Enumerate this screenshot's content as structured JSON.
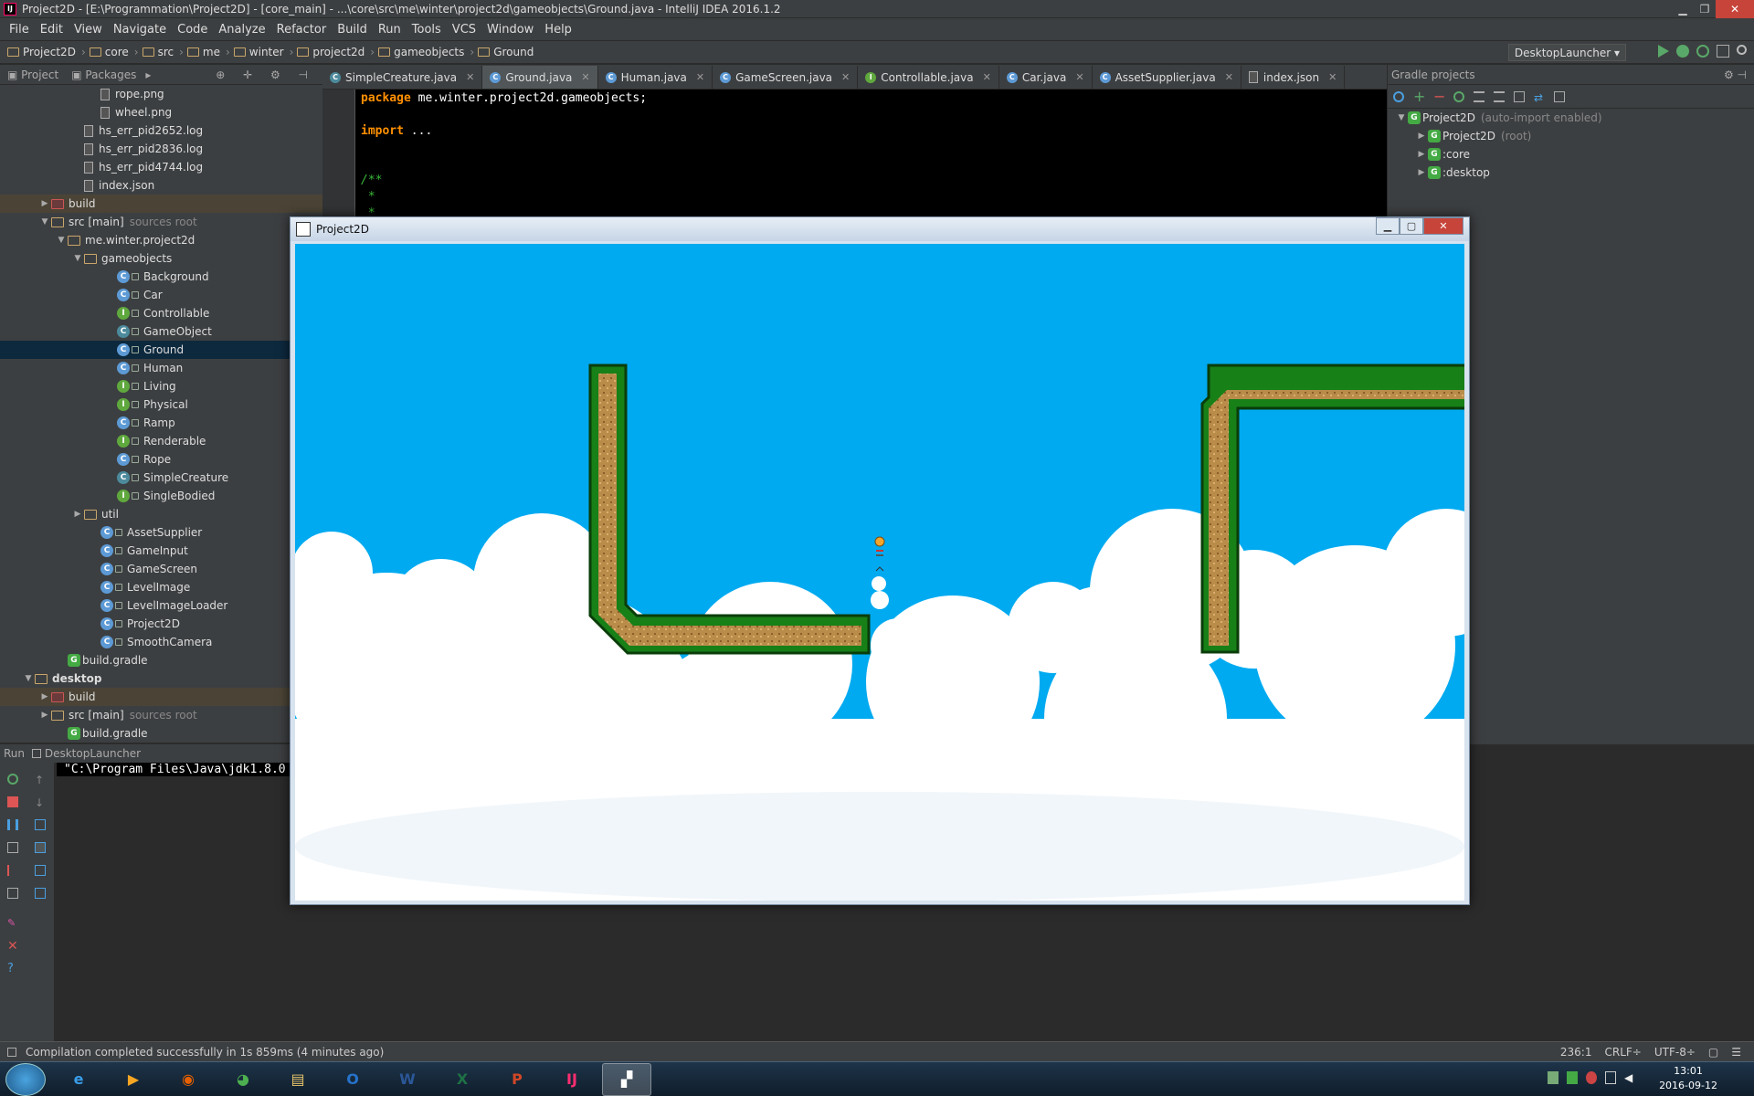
{
  "window": {
    "title": "Project2D - [E:\\Programmation\\Project2D] - [core_main] - ...\\core\\src\\me\\winter\\project2d\\gameobjects\\Ground.java - IntelliJ IDEA 2016.1.2",
    "logo": "IJ"
  },
  "menu": [
    "File",
    "Edit",
    "View",
    "Navigate",
    "Code",
    "Analyze",
    "Refactor",
    "Build",
    "Run",
    "Tools",
    "VCS",
    "Window",
    "Help"
  ],
  "breadcrumb": [
    "Project2D",
    "core",
    "src",
    "me",
    "winter",
    "project2d",
    "gameobjects",
    "Ground"
  ],
  "run_config": "DesktopLauncher",
  "project_panel": {
    "tabs": [
      "Project",
      "Packages"
    ],
    "tree": [
      {
        "label": "rope.png",
        "indent": 5,
        "icon": "file"
      },
      {
        "label": "wheel.png",
        "indent": 5,
        "icon": "file"
      },
      {
        "label": "hs_err_pid2652.log",
        "indent": 4,
        "icon": "file"
      },
      {
        "label": "hs_err_pid2836.log",
        "indent": 4,
        "icon": "file"
      },
      {
        "label": "hs_err_pid4744.log",
        "indent": 4,
        "icon": "file"
      },
      {
        "label": "index.json",
        "indent": 4,
        "icon": "file"
      },
      {
        "label": "build",
        "indent": 2,
        "icon": "folder-red",
        "arrow": "▶",
        "hl": true
      },
      {
        "label": "src [main]",
        "suffix": "sources root",
        "indent": 2,
        "icon": "folder",
        "arrow": "▼"
      },
      {
        "label": "me.winter.project2d",
        "indent": 3,
        "icon": "folder",
        "arrow": "▼"
      },
      {
        "label": "gameobjects",
        "indent": 4,
        "icon": "folder",
        "arrow": "▼"
      },
      {
        "label": "Background",
        "indent": 6,
        "icon": "c"
      },
      {
        "label": "Car",
        "indent": 6,
        "icon": "c"
      },
      {
        "label": "Controllable",
        "indent": 6,
        "icon": "i"
      },
      {
        "label": "GameObject",
        "indent": 6,
        "icon": "a"
      },
      {
        "label": "Ground",
        "indent": 6,
        "icon": "c",
        "sel": true
      },
      {
        "label": "Human",
        "indent": 6,
        "icon": "c"
      },
      {
        "label": "Living",
        "indent": 6,
        "icon": "i"
      },
      {
        "label": "Physical",
        "indent": 6,
        "icon": "i"
      },
      {
        "label": "Ramp",
        "indent": 6,
        "icon": "c"
      },
      {
        "label": "Renderable",
        "indent": 6,
        "icon": "i"
      },
      {
        "label": "Rope",
        "indent": 6,
        "icon": "c"
      },
      {
        "label": "SimpleCreature",
        "indent": 6,
        "icon": "a"
      },
      {
        "label": "SingleBodied",
        "indent": 6,
        "icon": "i"
      },
      {
        "label": "util",
        "indent": 4,
        "icon": "folder",
        "arrow": "▶"
      },
      {
        "label": "AssetSupplier",
        "indent": 5,
        "icon": "c"
      },
      {
        "label": "GameInput",
        "indent": 5,
        "icon": "c"
      },
      {
        "label": "GameScreen",
        "indent": 5,
        "icon": "c"
      },
      {
        "label": "LevelImage",
        "indent": 5,
        "icon": "c"
      },
      {
        "label": "LevelImageLoader",
        "indent": 5,
        "icon": "c"
      },
      {
        "label": "Project2D",
        "indent": 5,
        "icon": "c"
      },
      {
        "label": "SmoothCamera",
        "indent": 5,
        "icon": "c"
      },
      {
        "label": "build.gradle",
        "indent": 3,
        "icon": "g"
      },
      {
        "label": "desktop",
        "indent": 1,
        "icon": "folder",
        "arrow": "▼",
        "bold": true
      },
      {
        "label": "build",
        "indent": 2,
        "icon": "folder-red",
        "arrow": "▶",
        "hl": true
      },
      {
        "label": "src [main]",
        "suffix": "sources root",
        "indent": 2,
        "icon": "folder",
        "arrow": "▶"
      },
      {
        "label": "build.gradle",
        "indent": 3,
        "icon": "g"
      }
    ]
  },
  "editor_tabs": [
    {
      "label": "SimpleCreature.java",
      "icon": "a"
    },
    {
      "label": "Ground.java",
      "icon": "c",
      "active": true
    },
    {
      "label": "Human.java",
      "icon": "c"
    },
    {
      "label": "GameScreen.java",
      "icon": "c"
    },
    {
      "label": "Controllable.java",
      "icon": "i"
    },
    {
      "label": "Car.java",
      "icon": "c"
    },
    {
      "label": "AssetSupplier.java",
      "icon": "c"
    },
    {
      "label": "index.json",
      "icon": "file"
    }
  ],
  "code": {
    "line1_kw": "package",
    "line1_rest": " me.winter.project2d.gameobjects;",
    "line2_kw": "import",
    "line2_rest": " ...",
    "line3": "/**",
    "line4": " *",
    "line5": " *"
  },
  "gradle": {
    "title": "Gradle projects",
    "items": [
      {
        "label": "Project2D",
        "suffix": "(auto-import enabled)",
        "arrow": "▼",
        "indent": 0
      },
      {
        "label": "Project2D",
        "suffix": "(root)",
        "arrow": "▶",
        "indent": 1
      },
      {
        "label": ":core",
        "arrow": "▶",
        "indent": 1
      },
      {
        "label": ":desktop",
        "arrow": "▶",
        "indent": 1
      }
    ]
  },
  "run_panel": {
    "title": "Run",
    "config": "DesktopLauncher",
    "console": "\"C:\\Program Files\\Java\\jdk1.8.0"
  },
  "status": {
    "message": "Compilation completed successfully in 1s 859ms (4 minutes ago)",
    "position": "236:1",
    "line_sep": "CRLF÷",
    "encoding": "UTF-8÷"
  },
  "game_window": {
    "title": "Project2D"
  },
  "taskbar": {
    "apps": [
      {
        "name": "internet-explorer",
        "glyph": "e",
        "color": "#3a9de8"
      },
      {
        "name": "media-player",
        "glyph": "▶",
        "color": "#f6a623"
      },
      {
        "name": "firefox",
        "glyph": "◉",
        "color": "#e66000"
      },
      {
        "name": "chrome",
        "glyph": "◕",
        "color": "#4caf50"
      },
      {
        "name": "file-explorer",
        "glyph": "▤",
        "color": "#e8c56a"
      },
      {
        "name": "outlook",
        "glyph": "O",
        "color": "#2673c9"
      },
      {
        "name": "word",
        "glyph": "W",
        "color": "#2b5797"
      },
      {
        "name": "excel",
        "glyph": "X",
        "color": "#1e7145"
      },
      {
        "name": "powerpoint",
        "glyph": "P",
        "color": "#d24726"
      },
      {
        "name": "intellij",
        "glyph": "IJ",
        "color": "#ff2d70"
      },
      {
        "name": "java-app",
        "glyph": "▞",
        "color": "#ffffff",
        "active": true
      }
    ],
    "time": "13:01",
    "date": "2016-09-12"
  }
}
